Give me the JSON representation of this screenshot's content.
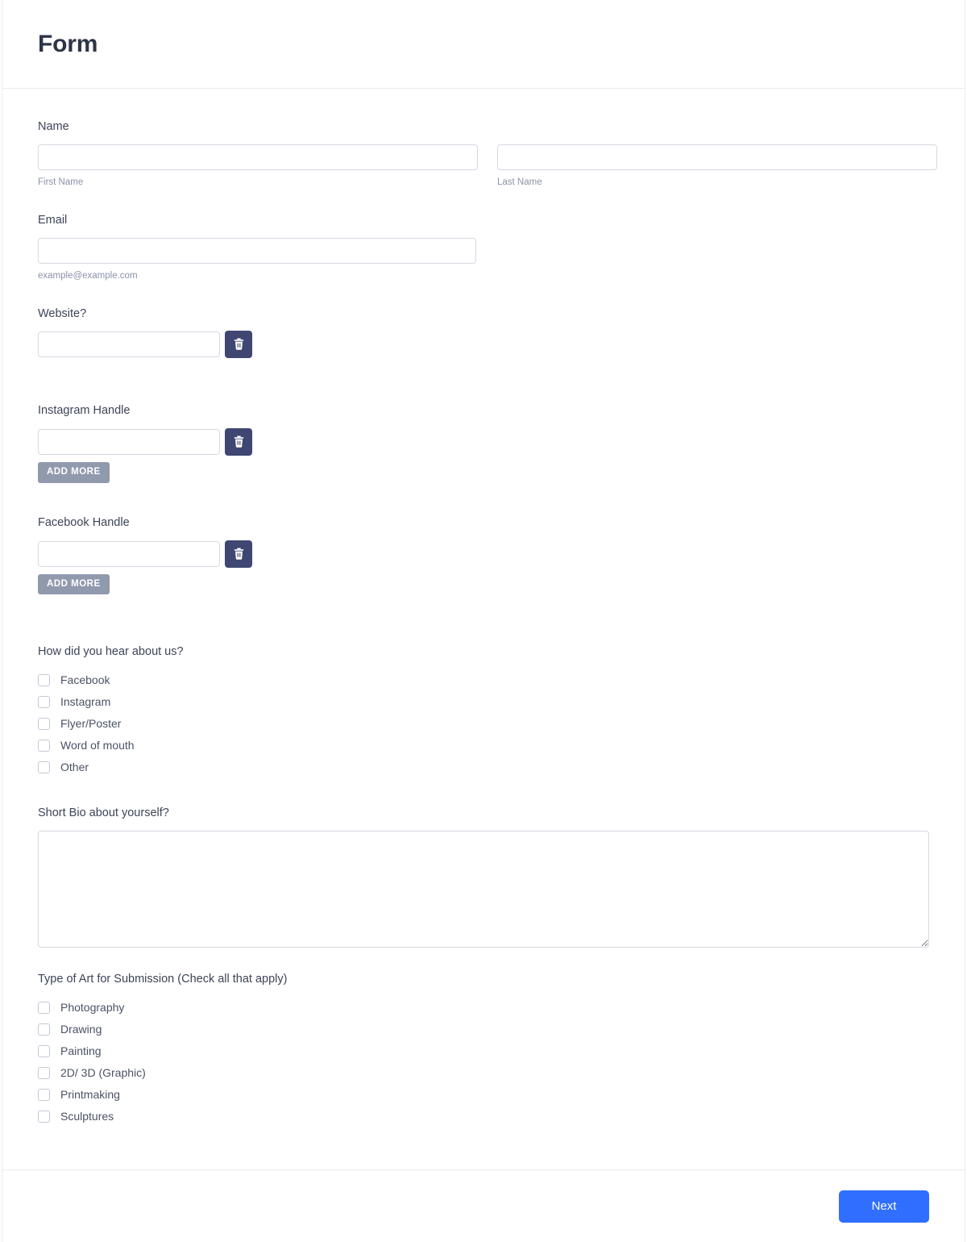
{
  "header": {
    "title": "Form"
  },
  "fields": {
    "name": {
      "label": "Name",
      "first": {
        "value": "",
        "placeholder": "",
        "sublabel": "First Name"
      },
      "last": {
        "value": "",
        "placeholder": "",
        "sublabel": "Last Name"
      }
    },
    "email": {
      "label": "Email",
      "value": "",
      "placeholder": "",
      "sublabel": "example@example.com"
    },
    "website": {
      "label": "Website?",
      "value": "",
      "placeholder": "",
      "delete_icon": "trash-icon"
    },
    "instagram": {
      "label": "Instagram Handle",
      "value": "",
      "placeholder": "",
      "delete_icon": "trash-icon",
      "add_more_label": "ADD MORE"
    },
    "facebook": {
      "label": "Facebook Handle",
      "value": "",
      "placeholder": "",
      "delete_icon": "trash-icon",
      "add_more_label": "ADD MORE"
    },
    "hear_about": {
      "label": "How did you hear about us?",
      "options": [
        {
          "label": "Facebook",
          "checked": false
        },
        {
          "label": "Instagram",
          "checked": false
        },
        {
          "label": "Flyer/Poster",
          "checked": false
        },
        {
          "label": "Word of mouth",
          "checked": false
        },
        {
          "label": "Other",
          "checked": false
        }
      ]
    },
    "bio": {
      "label": "Short Bio about yourself?",
      "value": "",
      "placeholder": ""
    },
    "art_type": {
      "label": "Type of Art for Submission (Check all that apply)",
      "options": [
        {
          "label": "Photography",
          "checked": false
        },
        {
          "label": "Drawing",
          "checked": false
        },
        {
          "label": "Painting",
          "checked": false
        },
        {
          "label": "2D/ 3D (Graphic)",
          "checked": false
        },
        {
          "label": "Printmaking",
          "checked": false
        },
        {
          "label": "Sculptures",
          "checked": false
        }
      ]
    }
  },
  "footer": {
    "next_label": "Next"
  },
  "colors": {
    "title": "#2e3447",
    "label": "#3d4457",
    "sublabel": "#8b92a8",
    "input_border": "#d7d8e3",
    "delete_button": "#3f4672",
    "add_more_button": "#9199ad",
    "next_button": "#2f6eff",
    "checkbox_border": "#c6c9d8"
  }
}
